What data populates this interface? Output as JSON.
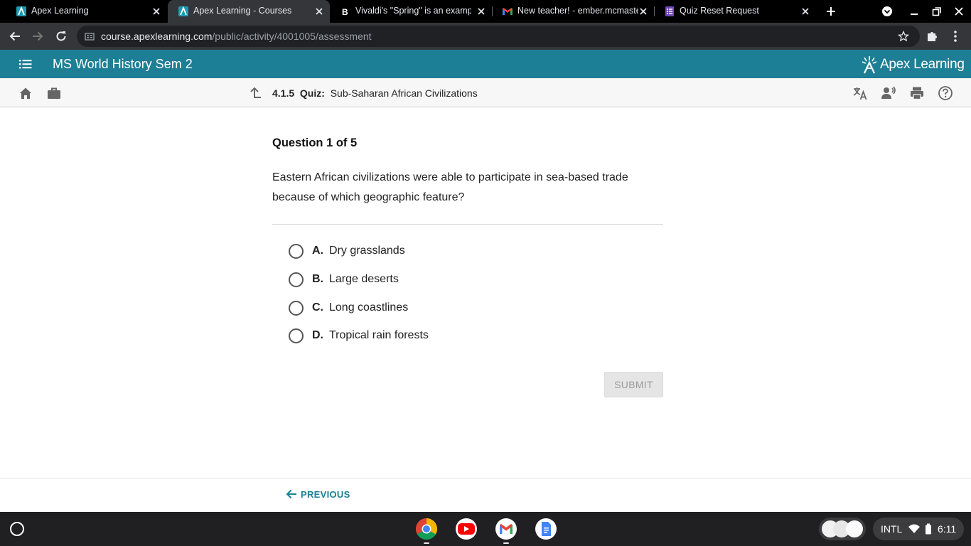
{
  "browser": {
    "tabs": [
      {
        "title": "Apex Learning",
        "icon": "apex-favicon",
        "active": false
      },
      {
        "title": "Apex Learning - Courses",
        "icon": "apex-favicon",
        "active": true
      },
      {
        "title": "Vivaldi's \"Spring\" is an exampl",
        "icon": "brainly-favicon",
        "active": false
      },
      {
        "title": "New teacher! - ember.mcmaste",
        "icon": "gmail-favicon",
        "active": false
      },
      {
        "title": "Quiz Reset Request",
        "icon": "forms-favicon",
        "active": false
      }
    ],
    "url_domain": "course.apexlearning.com",
    "url_path": "/public/activity/4001005/assessment"
  },
  "app": {
    "course_title": "MS World History Sem 2",
    "logo_text": "Apex Learning",
    "breadcrumb": {
      "number": "4.1.5",
      "type": "Quiz:",
      "title": "Sub-Saharan African Civilizations"
    }
  },
  "question": {
    "header": "Question 1 of 5",
    "text": "Eastern African civilizations were able to participate in sea-based trade because of which geographic feature?",
    "options": [
      {
        "letter": "A.",
        "text": "Dry grasslands"
      },
      {
        "letter": "B.",
        "text": "Large deserts"
      },
      {
        "letter": "C.",
        "text": "Long coastlines"
      },
      {
        "letter": "D.",
        "text": "Tropical rain forests"
      }
    ],
    "submit_label": "SUBMIT",
    "submit_enabled": false
  },
  "footer": {
    "previous_label": "PREVIOUS"
  },
  "shelf": {
    "apps": [
      "chrome-icon",
      "youtube-icon",
      "gmail-icon",
      "docs-icon"
    ],
    "ime_label": "INTL",
    "time": "6:11"
  },
  "colors": {
    "apex_teal": "#1d7f95",
    "tab_active": "#35363a",
    "shelf": "#201f22"
  }
}
